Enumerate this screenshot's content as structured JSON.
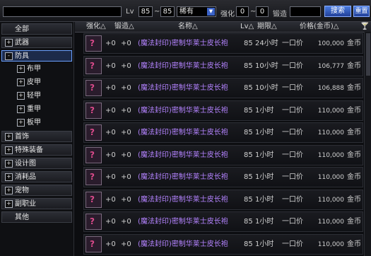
{
  "topbar": {
    "search_value": "",
    "lv_label": "Lv",
    "lv_min": "85",
    "lv_sep": "~",
    "lv_max": "85",
    "rarity_value": "稀有",
    "enhance_label": "强化",
    "enhance_min": "0",
    "enhance_sep": "~",
    "enhance_max": "0",
    "forge_label": "锻造",
    "search_button": "搜索",
    "reset_button": "重置"
  },
  "sidebar": {
    "items": [
      {
        "label": "全部",
        "type": "top",
        "plus": ""
      },
      {
        "label": "武器",
        "type": "top",
        "plus": "+"
      },
      {
        "label": "防具",
        "type": "top",
        "plus": "-",
        "selected": true
      },
      {
        "label": "布甲",
        "type": "sub",
        "plus": "+"
      },
      {
        "label": "皮甲",
        "type": "sub",
        "plus": "+"
      },
      {
        "label": "轻甲",
        "type": "sub",
        "plus": "+"
      },
      {
        "label": "重甲",
        "type": "sub",
        "plus": "+"
      },
      {
        "label": "板甲",
        "type": "sub",
        "plus": "+"
      },
      {
        "label": "首饰",
        "type": "top",
        "plus": "+"
      },
      {
        "label": "特殊装备",
        "type": "top",
        "plus": "+"
      },
      {
        "label": "设计图",
        "type": "top",
        "plus": "+"
      },
      {
        "label": "消耗品",
        "type": "top",
        "plus": "+"
      },
      {
        "label": "宠物",
        "type": "top",
        "plus": "+"
      },
      {
        "label": "副职业",
        "type": "top",
        "plus": "+"
      },
      {
        "label": "其他",
        "type": "top",
        "plus": ""
      }
    ]
  },
  "table": {
    "headers": {
      "enhance": "强化△",
      "forge": "锻造△",
      "name": "名称△",
      "lv": "Lv△",
      "period": "期限△",
      "price": "价格(金币)△"
    },
    "rows": [
      {
        "enhance": "+0",
        "forge": "+0",
        "name": "(魔法封印)密制华莱士皮长袍",
        "lv": "85",
        "time": "24小时",
        "mode": "一口价",
        "price": "100,000",
        "unit": "金币"
      },
      {
        "enhance": "+0",
        "forge": "+0",
        "name": "(魔法封印)密制华莱士皮长袍",
        "lv": "85",
        "time": "10小时",
        "mode": "一口价",
        "price": "106,777",
        "unit": "金币"
      },
      {
        "enhance": "+0",
        "forge": "+0",
        "name": "(魔法封印)密制华莱士皮长袍",
        "lv": "85",
        "time": "10小时",
        "mode": "一口价",
        "price": "106,888",
        "unit": "金币"
      },
      {
        "enhance": "+0",
        "forge": "+0",
        "name": "(魔法封印)密制华莱士皮长袍",
        "lv": "85",
        "time": "1小时",
        "mode": "一口价",
        "price": "110,000",
        "unit": "金币"
      },
      {
        "enhance": "+0",
        "forge": "+0",
        "name": "(魔法封印)密制华莱士皮长袍",
        "lv": "85",
        "time": "1小时",
        "mode": "一口价",
        "price": "110,000",
        "unit": "金币"
      },
      {
        "enhance": "+0",
        "forge": "+0",
        "name": "(魔法封印)密制华莱士皮长袍",
        "lv": "85",
        "time": "1小时",
        "mode": "一口价",
        "price": "110,000",
        "unit": "金币"
      },
      {
        "enhance": "+0",
        "forge": "+0",
        "name": "(魔法封印)密制华莱士皮长袍",
        "lv": "85",
        "time": "1小时",
        "mode": "一口价",
        "price": "110,000",
        "unit": "金币"
      },
      {
        "enhance": "+0",
        "forge": "+0",
        "name": "(魔法封印)密制华莱士皮长袍",
        "lv": "85",
        "time": "1小时",
        "mode": "一口价",
        "price": "110,000",
        "unit": "金币"
      },
      {
        "enhance": "+0",
        "forge": "+0",
        "name": "(魔法封印)密制华莱士皮长袍",
        "lv": "85",
        "time": "1小时",
        "mode": "一口价",
        "price": "110,000",
        "unit": "金币"
      },
      {
        "enhance": "+0",
        "forge": "+0",
        "name": "(魔法封印)密制华莱士皮长袍",
        "lv": "85",
        "time": "1小时",
        "mode": "一口价",
        "price": "110,000",
        "unit": "金币"
      }
    ]
  }
}
